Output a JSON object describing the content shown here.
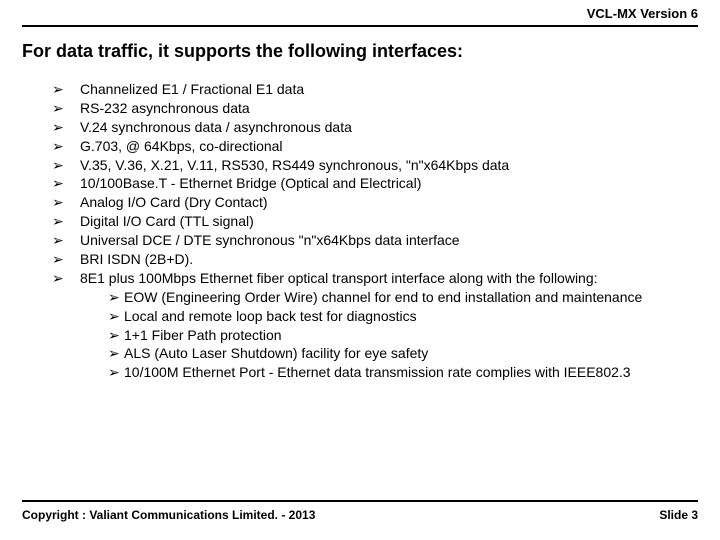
{
  "header": {
    "product": "VCL-MX Version 6"
  },
  "title": "For data traffic, it supports the following interfaces:",
  "items": [
    {
      "text": "Channelized E1 / Fractional E1 data"
    },
    {
      "text": "RS-232 asynchronous data"
    },
    {
      "text": "V.24 synchronous data / asynchronous data"
    },
    {
      "text": "G.703, @ 64Kbps, co-directional"
    },
    {
      "text": "V.35, V.36, X.21, V.11, RS530, RS449 synchronous, \"n\"x64Kbps data"
    },
    {
      "text": "10/100Base.T - Ethernet Bridge (Optical and Electrical)"
    },
    {
      "text": "Analog I/O Card (Dry Contact)"
    },
    {
      "text": "Digital I/O Card (TTL signal)"
    },
    {
      "text": "Universal DCE / DTE synchronous \"n\"x64Kbps data interface"
    },
    {
      "text": "BRI ISDN (2B+D)."
    },
    {
      "text": "8E1 plus 100Mbps Ethernet fiber optical transport interface along with the following:"
    }
  ],
  "subitems": [
    {
      "text": "EOW (Engineering Order Wire) channel for end to end installation and maintenance"
    },
    {
      "text": "Local and remote loop back test for diagnostics"
    },
    {
      "text": "1+1 Fiber Path protection"
    },
    {
      "text": "ALS (Auto Laser Shutdown) facility for eye safety"
    },
    {
      "text": "10/100M Ethernet Port - Ethernet data transmission rate complies with IEEE802.3"
    }
  ],
  "footer": {
    "copyright": "Copyright : Valiant Communications Limited. - 2013",
    "slide": "Slide 3"
  },
  "bullet_glyph": "➢"
}
